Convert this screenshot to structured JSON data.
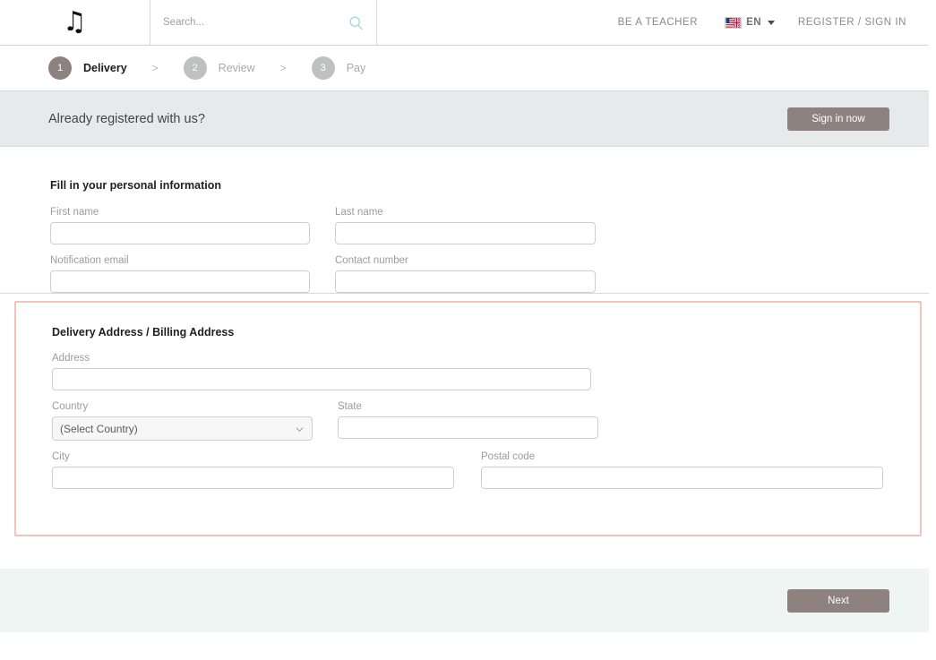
{
  "header": {
    "logo_icon": "music-note-icon",
    "search": {
      "placeholder": "Search...",
      "value": "",
      "icon": "search-icon"
    },
    "be_a_teacher": "BE A TEACHER",
    "language": {
      "flag_icon": "us-uk-flag-icon",
      "label": "EN",
      "caret_icon": "chevron-down-icon"
    },
    "register_sign_in": "REGISTER / SIGN IN"
  },
  "steps": [
    {
      "number": "1",
      "label": "Delivery",
      "state": "active"
    },
    {
      "number": "2",
      "label": "Review",
      "state": "inactive"
    },
    {
      "number": "3",
      "label": "Pay",
      "state": "inactive"
    }
  ],
  "step_separator": ">",
  "banner": {
    "text": "Already registered with us?",
    "button_label": "Sign in now"
  },
  "personal": {
    "title": "Fill in your personal information",
    "fields": [
      {
        "label": "First name",
        "value": ""
      },
      {
        "label": "Last name",
        "value": ""
      },
      {
        "label": "Notification email",
        "value": ""
      },
      {
        "label": "Contact number",
        "value": ""
      }
    ]
  },
  "address": {
    "title": "Delivery Address / Billing Address",
    "address_label": "Address",
    "address_value": "",
    "country_label": "Country",
    "country_selected": "(Select Country)",
    "country_options": [
      "(Select Country)"
    ],
    "state_label": "State",
    "state_value": "",
    "city_label": "City",
    "city_value": "",
    "postal_label": "Postal code",
    "postal_value": ""
  },
  "footer": {
    "next_label": "Next"
  },
  "colors": {
    "accent_brown": "#8d8280",
    "validation_pink": "#f4c3c0",
    "banner_gray": "#e6eaea",
    "footer_mint": "#eef5f2",
    "search_teal": "#9dd8cd"
  }
}
